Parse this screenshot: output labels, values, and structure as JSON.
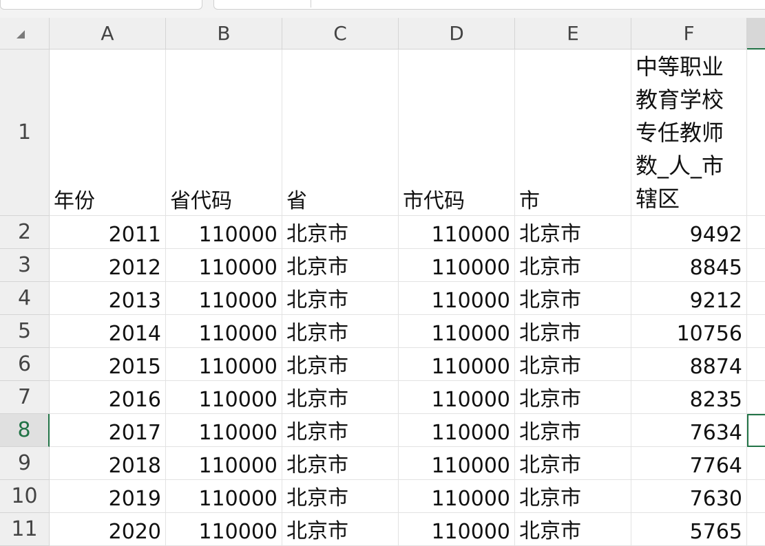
{
  "columns": [
    "A",
    "B",
    "C",
    "D",
    "E",
    "F"
  ],
  "row_numbers": [
    "1",
    "2",
    "3",
    "4",
    "5",
    "6",
    "7",
    "8",
    "9",
    "10",
    "11"
  ],
  "header_row": {
    "A": "年份",
    "B": "省代码",
    "C": "省",
    "D": "市代码",
    "E": "市",
    "F": "中等职业教育学校专任教师数_人_市辖区"
  },
  "rows": [
    {
      "A": "2011",
      "B": "110000",
      "C": "北京市",
      "D": "110000",
      "E": "北京市",
      "F": "9492"
    },
    {
      "A": "2012",
      "B": "110000",
      "C": "北京市",
      "D": "110000",
      "E": "北京市",
      "F": "8845"
    },
    {
      "A": "2013",
      "B": "110000",
      "C": "北京市",
      "D": "110000",
      "E": "北京市",
      "F": "9212"
    },
    {
      "A": "2014",
      "B": "110000",
      "C": "北京市",
      "D": "110000",
      "E": "北京市",
      "F": "10756"
    },
    {
      "A": "2015",
      "B": "110000",
      "C": "北京市",
      "D": "110000",
      "E": "北京市",
      "F": "8874"
    },
    {
      "A": "2016",
      "B": "110000",
      "C": "北京市",
      "D": "110000",
      "E": "北京市",
      "F": "8235"
    },
    {
      "A": "2017",
      "B": "110000",
      "C": "北京市",
      "D": "110000",
      "E": "北京市",
      "F": "7634"
    },
    {
      "A": "2018",
      "B": "110000",
      "C": "北京市",
      "D": "110000",
      "E": "北京市",
      "F": "7764"
    },
    {
      "A": "2019",
      "B": "110000",
      "C": "北京市",
      "D": "110000",
      "E": "北京市",
      "F": "7630"
    },
    {
      "A": "2020",
      "B": "110000",
      "C": "北京市",
      "D": "110000",
      "E": "北京市",
      "F": "5765"
    }
  ],
  "active_row": "8",
  "accent_color": "#217346"
}
